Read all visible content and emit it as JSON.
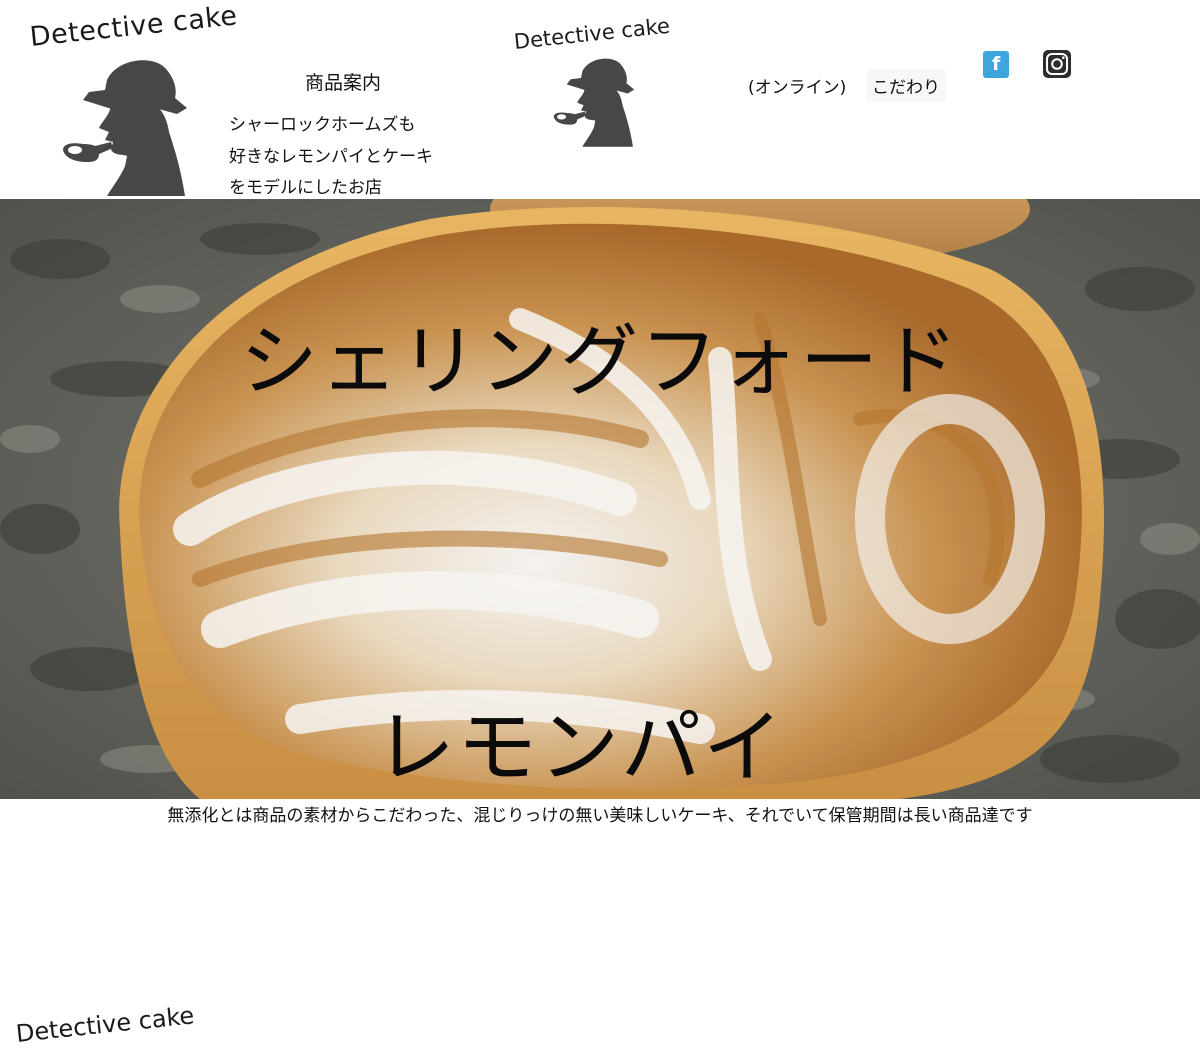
{
  "header": {
    "logo_text": "Detective  cake",
    "nav": {
      "products": "商品案内",
      "online": "(オンライン)",
      "kodawari": "こだわり"
    },
    "tagline": [
      "シャーロックホームズも",
      "好きなレモンパイとケーキ",
      "をモデルにしたお店"
    ],
    "social": {
      "facebook_icon": "facebook-icon",
      "instagram_icon": "instagram-icon",
      "facebook_color": "#3ea6dc"
    }
  },
  "hero": {
    "title": "シェリングフォード",
    "subtitle": "レモンパイ"
  },
  "description": "無添化とは商品の素材からこだわった、混じりっけの無い美味しいケーキ、それでいて保管期間は長い商品達です",
  "footer": {
    "logo_text": "Detective  cake"
  }
}
